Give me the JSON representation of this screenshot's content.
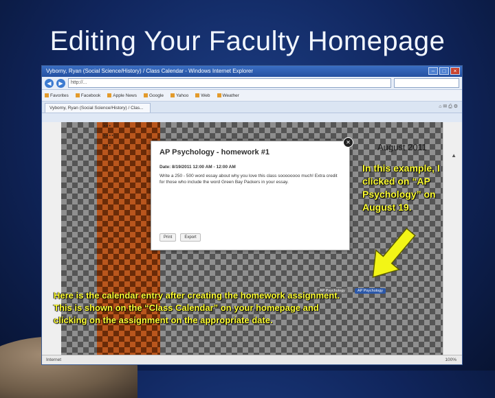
{
  "slide": {
    "title": "Editing Your Faculty Homepage",
    "callout_right": "In this example, I clicked on “AP Psychology” on August 19.",
    "callout_bottom": "Here is the calendar entry after creating the homework assignment. This is shown on the “Class Calendar” on your homepage and clicking on the assignment on the appropriate date."
  },
  "browser": {
    "window_title": "Vyborny, Ryan (Social Science/History) / Class Calendar - Windows Internet Explorer",
    "url": "http://...",
    "favorites": [
      "Favorites",
      "Facebook",
      "Apple News",
      "Google",
      "Yahoo",
      "Web",
      "Weather"
    ],
    "tab_label": "Vyborny, Ryan (Social Science/History) / Clas..."
  },
  "calendar": {
    "month_label": "August 2011",
    "events": [
      "AP Psychology",
      "AP Psychology"
    ]
  },
  "modal": {
    "title": "AP Psychology - homework #1",
    "date": "Date: 8/19/2011 12:00 AM - 12:00 AM",
    "description": "Write a 250 - 500 word essay about why you love this class soooooooo much! Extra credit for those who include the word Green Bay Packers in your essay.",
    "print_label": "Print",
    "export_label": "Export"
  },
  "status": {
    "text": "Internet",
    "zoom": "100%"
  },
  "colors": {
    "callout_text": "#ffff33",
    "title_text": "#f1f6ff",
    "arrow_fill": "#f3f516"
  }
}
